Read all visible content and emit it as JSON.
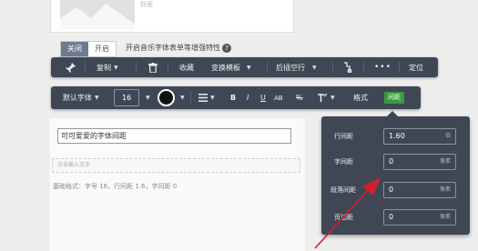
{
  "top_card": {
    "caption": "封面"
  },
  "toggle": {
    "off_label": "关闭",
    "on_label": "开启",
    "description": "开启音乐字体表单等增强特性",
    "help_glyph": "?"
  },
  "toolbar1": {
    "copy": "复制",
    "favorite": "收藏",
    "switch_template": "变换模板",
    "insert_blank_line": "后插空行",
    "more": "•••",
    "locate": "定位"
  },
  "toolbar2": {
    "font_family": "默认字体",
    "font_size": "16",
    "bold": "B",
    "italic": "I",
    "underline": "U",
    "letter_case": "AB",
    "percent": "%",
    "style": "格式",
    "spacing": "间距"
  },
  "content": {
    "input_value": "可可爱爱的字体间距",
    "click_placeholder": "点击输入文字",
    "base_style": "基础格式：字号 16，行间距 1.6，字间距 0"
  },
  "spacing_panel": {
    "rows": [
      {
        "label": "行间距",
        "value": "1.60",
        "unit": "倍"
      },
      {
        "label": "字间距",
        "value": "0",
        "unit": "像素"
      },
      {
        "label": "段落间距",
        "value": "0",
        "unit": "像素"
      },
      {
        "label": "页边距",
        "value": "0",
        "unit": "像素"
      }
    ]
  },
  "colors": {
    "toolbar_bg": "#3f4755",
    "spacing_active": "#3a9a3f",
    "arrow": "#d2202a",
    "toggle_active": "#6e7a8f"
  }
}
